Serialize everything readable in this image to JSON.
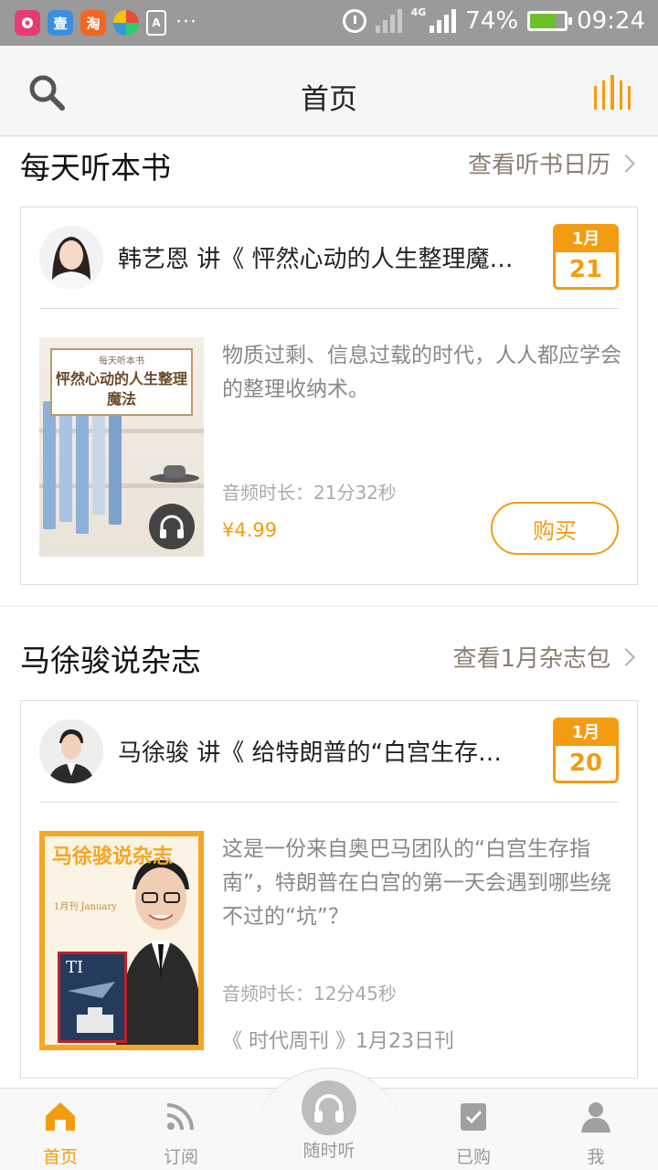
{
  "status_bar": {
    "apps": [
      "壹",
      "淘",
      "",
      ""
    ],
    "more": "···",
    "network": "4G",
    "battery": "74%",
    "time": "09:24",
    "battery_color": "#6cc02a"
  },
  "header": {
    "title": "首页",
    "left_icon": "search-icon",
    "right_icon": "audio-bars-icon",
    "accent": "#f39c12"
  },
  "daily_book": {
    "section_title": "每天听本书",
    "link_label": "查看听书日历",
    "card": {
      "speaker": "韩艺恩 讲《 怦然心动的人生整理魔…",
      "date_month": "1月",
      "date_day": "21",
      "cover_small": "每天听本书",
      "cover_title": "怦然心动的人生整理魔法",
      "description": "物质过剩、信息过载的时代，人人都应学会的整理收纳术。",
      "duration": "音频时长：21分32秒",
      "price": "¥4.99",
      "buy_label": "购买"
    }
  },
  "magazine": {
    "section_title": "马徐骏说杂志",
    "link_label": "查看1月杂志包",
    "card": {
      "speaker": "马徐骏 讲《 给特朗普的“白宫生存…",
      "date_month": "1月",
      "date_day": "20",
      "cover_title": "马徐骏说杂志",
      "cover_month": "1月刊 January",
      "description": "这是一份来自奥巴马团队的“白宫生存指南”，特朗普在白宫的第一天会遇到哪些绕不过的“坑”？",
      "duration": "音频时长：12分45秒",
      "source": "《 时代周刊 》1月23日刊"
    }
  },
  "bottom_nav": {
    "items": [
      {
        "label": "首页",
        "icon": "home-icon",
        "active": true
      },
      {
        "label": "订阅",
        "icon": "rss-icon",
        "active": false
      },
      {
        "label": "随时听",
        "icon": "headphones-icon",
        "active": false
      },
      {
        "label": "已购",
        "icon": "purchased-icon",
        "active": false
      },
      {
        "label": "我",
        "icon": "profile-icon",
        "active": false
      }
    ]
  }
}
